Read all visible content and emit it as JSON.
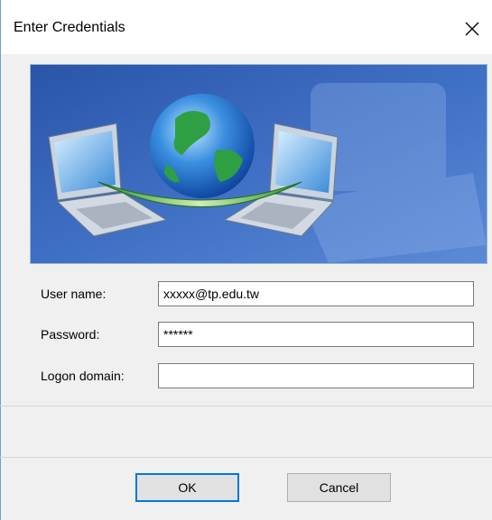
{
  "window": {
    "title": "Enter Credentials",
    "close_icon": "close-icon"
  },
  "banner": {
    "icon": "network-globe-laptops-illustration"
  },
  "form": {
    "username_label": "User name:",
    "username_value": "xxxxx@tp.edu.tw",
    "password_label": "Password:",
    "password_value": "******",
    "domain_label": "Logon domain:",
    "domain_value": ""
  },
  "buttons": {
    "ok_label": "OK",
    "cancel_label": "Cancel"
  },
  "colors": {
    "accent": "#0078d7",
    "dialog_bg": "#f0f0f0",
    "banner_bg": "#3a66b8"
  }
}
